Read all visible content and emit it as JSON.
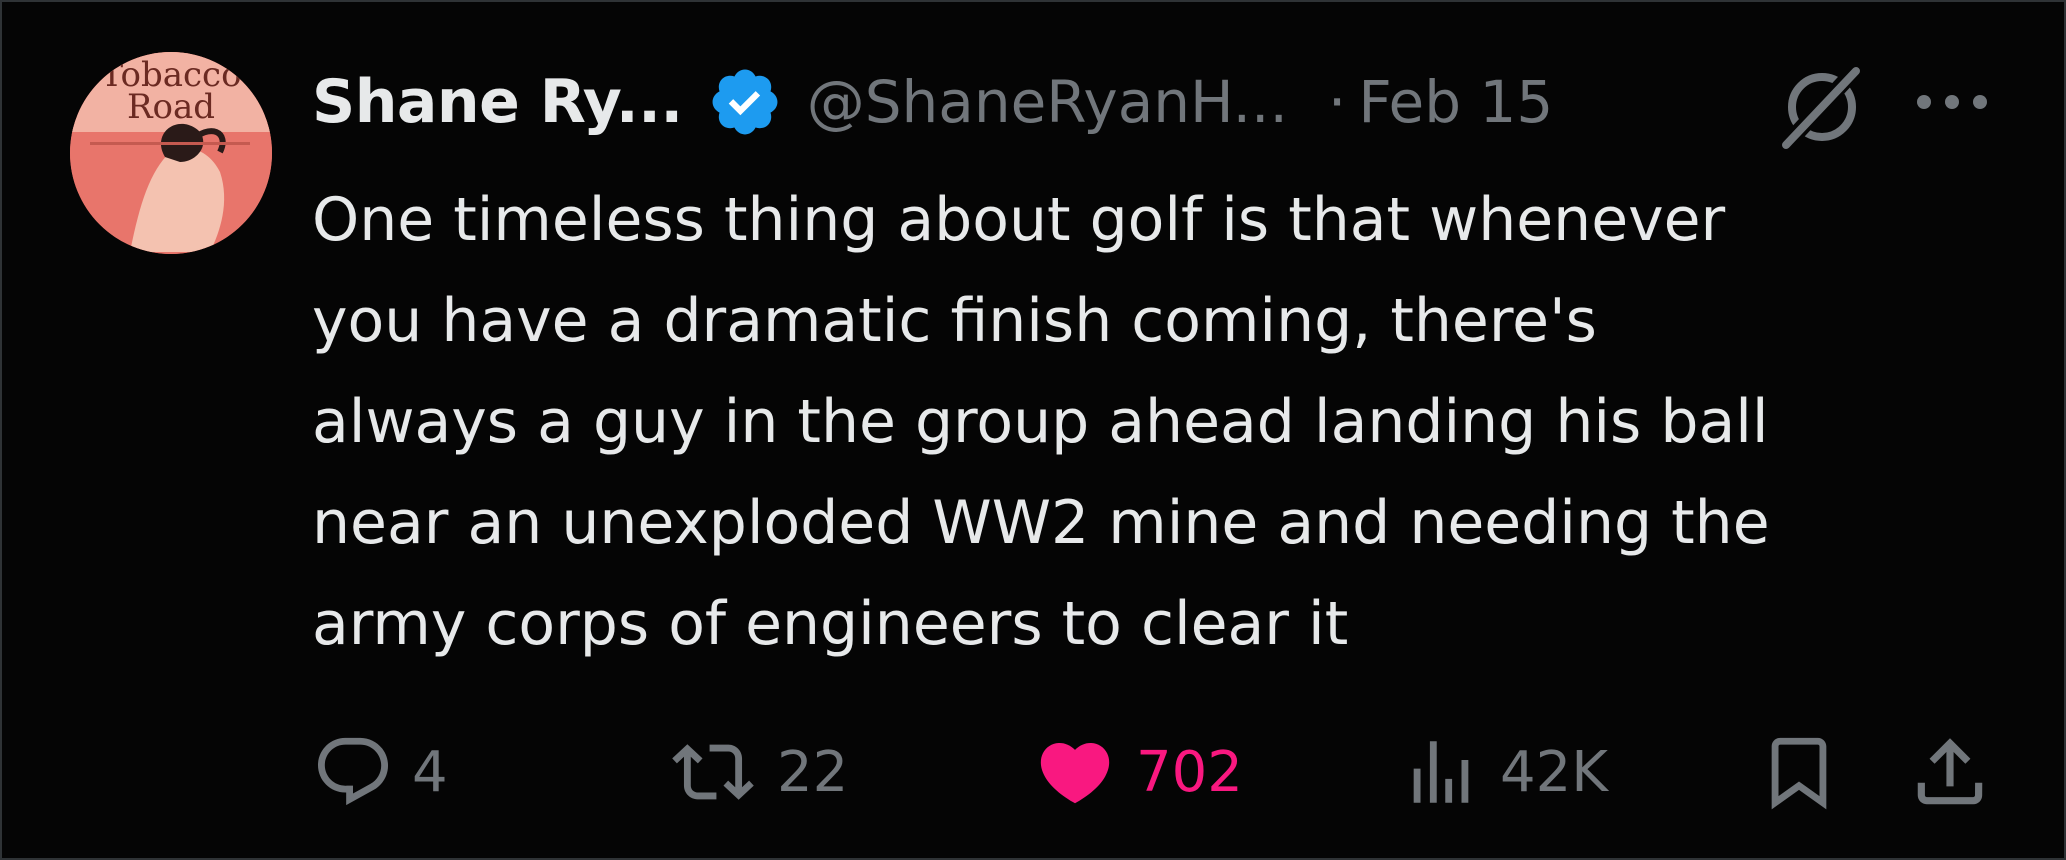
{
  "tweet": {
    "author": {
      "display_name": "Shane Ry...",
      "handle": "@ShaneRyanH...",
      "avatar_text_line1": "Tobacco",
      "avatar_text_line2": "Road",
      "verified": true
    },
    "separator": "·",
    "date": "Feb 15",
    "text_lines": [
      "One timeless thing about golf is that whenever",
      "you have a dramatic finish coming, there's",
      "always a guy in the group ahead landing his ball",
      "near an unexploded WW2 mine and needing the",
      "army corps of engineers to clear it"
    ],
    "actions": {
      "replies": "4",
      "reposts": "22",
      "likes": "702",
      "views": "42K"
    },
    "liked": true
  },
  "icons": {
    "verified": "verified-badge-icon",
    "grok": "grok-icon",
    "more": "more-options-icon",
    "reply": "reply-icon",
    "repost": "repost-icon",
    "like": "heart-icon",
    "views": "views-icon",
    "bookmark": "bookmark-icon",
    "share": "share-icon"
  },
  "colors": {
    "background": "#050505",
    "text": "#e7e9ea",
    "muted": "#71767b",
    "verified_blue": "#1d9bf0",
    "like_pink": "#f91880"
  }
}
